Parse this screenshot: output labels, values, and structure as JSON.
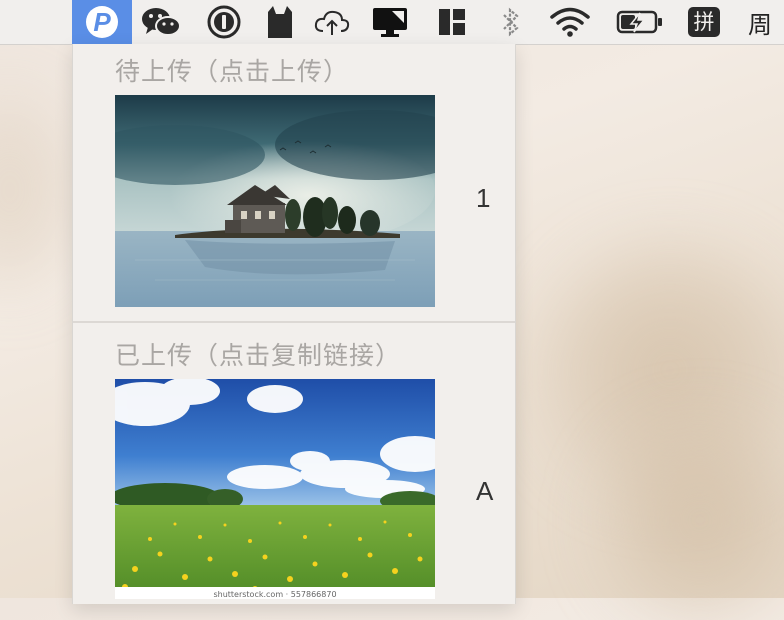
{
  "menubar": {
    "icons": [
      "pp-uploader-icon",
      "wechat-icon",
      "onepassword-icon",
      "cat-icon",
      "cloud-upload-icon",
      "display-icon",
      "layout-icon",
      "bluetooth-icon",
      "wifi-icon",
      "battery-charging-icon",
      "input-method-icon",
      "clock-icon"
    ],
    "app_letter": "P",
    "input_method_label": "拼",
    "clock_text": "周"
  },
  "menu": {
    "pending": {
      "title": "待上传（点击上传）",
      "image_description": "house-on-island-in-lake",
      "shortcut": "1"
    },
    "uploaded": {
      "title": "已上传（点击复制链接）",
      "image_description": "green-meadow-with-dandelions-and-blue-sky",
      "shortcut": "A",
      "watermark": "shutterstock.com · 557866870"
    }
  },
  "colors": {
    "menubar_bg": "#f1efed",
    "app_icon_bg": "#5a8ee6",
    "menu_bg": "#f2efec",
    "section_title": "#a9a6a3"
  }
}
